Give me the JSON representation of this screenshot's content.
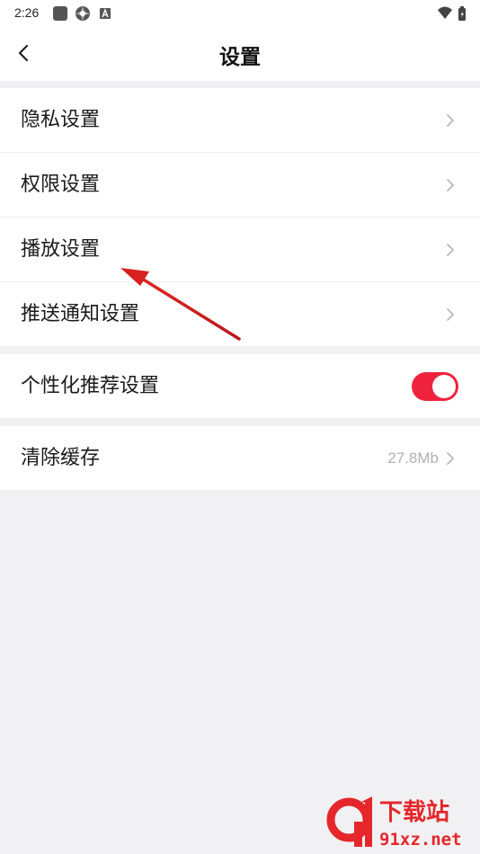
{
  "status_bar": {
    "time": "2:26",
    "left_icons": [
      "square-icon",
      "pinwheel-icon",
      "a-badge-icon"
    ],
    "right_icons": [
      "wifi-icon",
      "battery-icon"
    ]
  },
  "header": {
    "title": "设置",
    "back_icon": "back-chevron-icon"
  },
  "sections": [
    {
      "items": [
        {
          "label": "隐私设置"
        },
        {
          "label": "权限设置"
        },
        {
          "label": "播放设置"
        },
        {
          "label": "推送通知设置"
        }
      ]
    },
    {
      "items": [
        {
          "label": "个性化推荐设置",
          "toggle_on": true
        }
      ]
    },
    {
      "items": [
        {
          "label": "清除缓存",
          "value": "27.8Mb"
        }
      ]
    }
  ],
  "colors": {
    "accent": "#f0233e",
    "annotation_arrow": "#d8201f",
    "page_background": "#f1f1f3",
    "section_background": "#ffffff"
  },
  "watermark": {
    "brand_mark": "91",
    "name": "下载站",
    "domain": "91xz.net"
  }
}
